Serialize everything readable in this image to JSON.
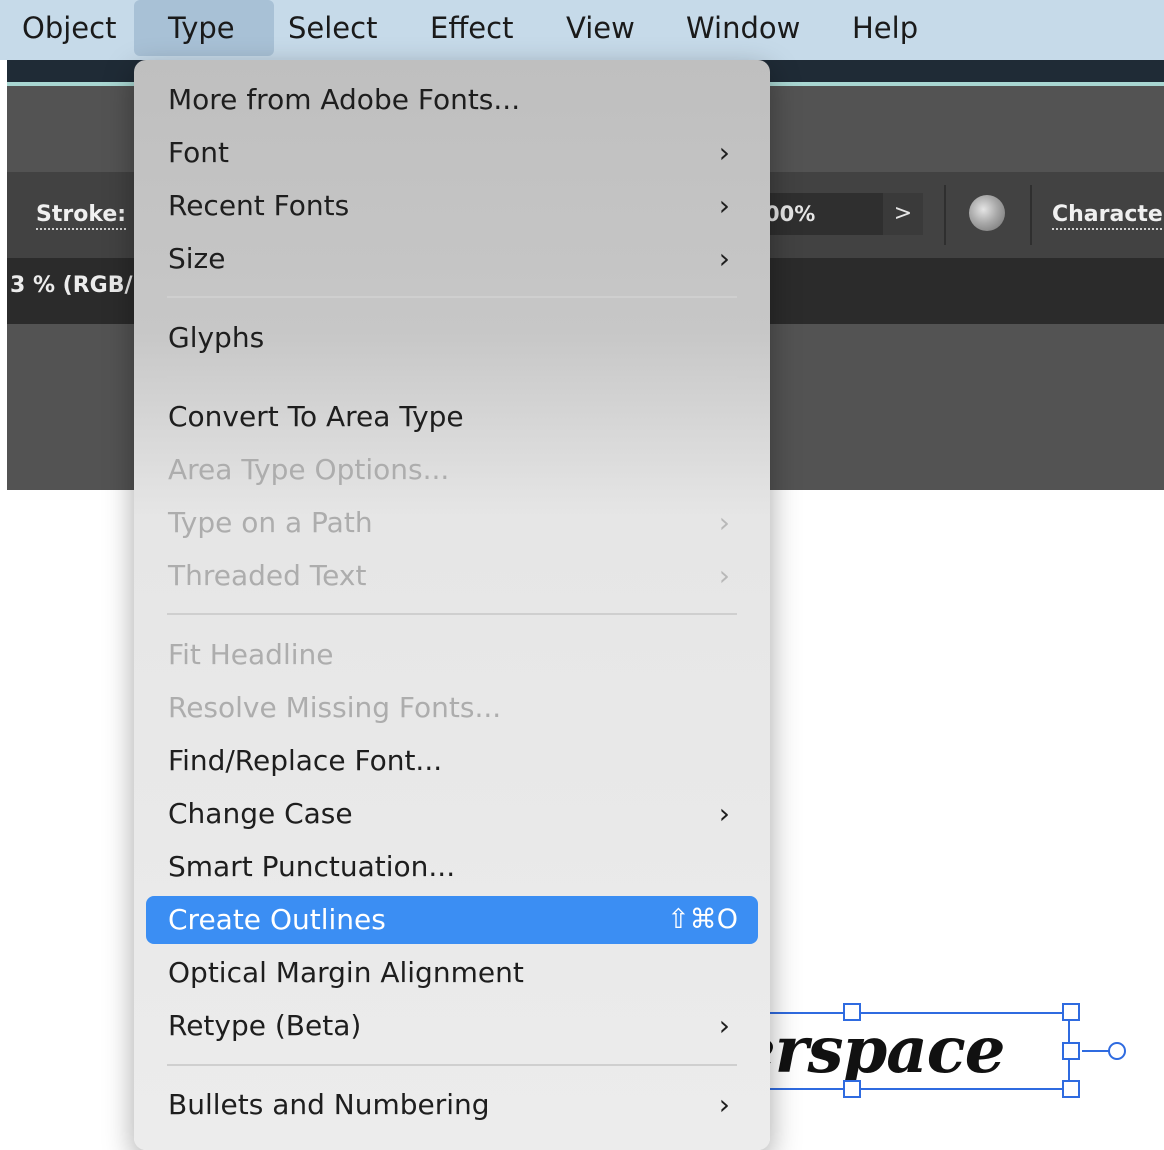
{
  "menubar": {
    "items": [
      "Object",
      "Type",
      "Select",
      "Effect",
      "View",
      "Window",
      "Help"
    ]
  },
  "control_bar": {
    "stroke_label": "Stroke:",
    "percent_value": "00%",
    "arrow_glyph": ">",
    "character_label": "Character"
  },
  "document_tab": {
    "title": "3 % (RGB/"
  },
  "artwork_text": "serspace",
  "type_menu": {
    "items": [
      {
        "label": "More from Adobe Fonts...",
        "enabled": true
      },
      {
        "label": "Font",
        "enabled": true,
        "submenu": true
      },
      {
        "label": "Recent Fonts",
        "enabled": true,
        "submenu": true
      },
      {
        "label": "Size",
        "enabled": true,
        "submenu": true
      },
      {
        "label": "Glyphs",
        "enabled": true
      },
      {
        "label": "Convert To Area Type",
        "enabled": true
      },
      {
        "label": "Area Type Options...",
        "enabled": false
      },
      {
        "label": "Type on a Path",
        "enabled": false,
        "submenu": true
      },
      {
        "label": "Threaded Text",
        "enabled": false,
        "submenu": true
      },
      {
        "label": "Fit Headline",
        "enabled": false
      },
      {
        "label": "Resolve Missing Fonts...",
        "enabled": false
      },
      {
        "label": "Find/Replace Font...",
        "enabled": true
      },
      {
        "label": "Change Case",
        "enabled": true,
        "submenu": true
      },
      {
        "label": "Smart Punctuation...",
        "enabled": true
      },
      {
        "label": "Create Outlines",
        "enabled": true,
        "highlighted": true,
        "shortcut": "⇧⌘O"
      },
      {
        "label": "Optical Margin Alignment",
        "enabled": true
      },
      {
        "label": "Retype (Beta)",
        "enabled": true,
        "submenu": true
      },
      {
        "label": "Bullets and Numbering",
        "enabled": true,
        "submenu": true
      }
    ],
    "chevron_glyph": "›"
  },
  "colors": {
    "menubar": "#c6dae9",
    "highlight": "#3b8ef3",
    "selection": "#2f6be0"
  }
}
